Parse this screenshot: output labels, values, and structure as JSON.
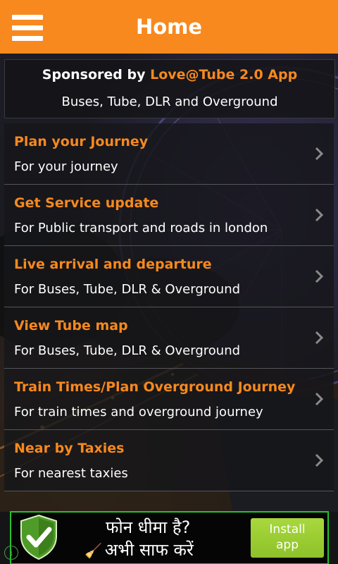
{
  "header": {
    "title": "Home",
    "menu_icon": "hamburger-icon"
  },
  "sponsor": {
    "prefix": "Sponsored by ",
    "brand": "Love@Tube 2.0 App",
    "subtitle": "Buses, Tube, DLR and Overground"
  },
  "menu": {
    "items": [
      {
        "title": "Plan your Journey",
        "subtitle": "For your journey"
      },
      {
        "title": "Get Service update",
        "subtitle": "For Public transport and roads in london"
      },
      {
        "title": "Live arrival and departure",
        "subtitle": "For Buses, Tube, DLR & Overground"
      },
      {
        "title": "View Tube map",
        "subtitle": "For Buses, Tube, DLR & Overground"
      },
      {
        "title": "Train Times/Plan Overground Journey",
        "subtitle": "For train times and overground journey"
      },
      {
        "title": "Near by Taxies",
        "subtitle": "For nearest taxies"
      }
    ],
    "chevron_icon": "chevron-right-icon"
  },
  "ad": {
    "line1": "फोन धीमा है?",
    "line2": "अभी साफ करें",
    "install_line1": "Install",
    "install_line2": "app",
    "info": "i",
    "shield_icon": "shield-check-icon",
    "broom_icon": "broom-icon"
  },
  "colors": {
    "accent": "#f7891e",
    "ad_border": "#25c22b",
    "install_button": "#98cc31"
  }
}
